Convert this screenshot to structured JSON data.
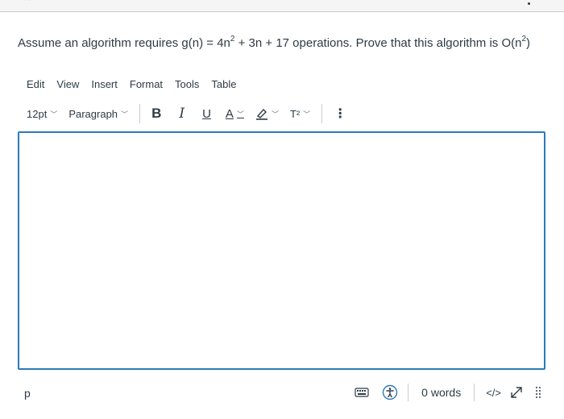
{
  "question": {
    "prefix": "Assume an algorithm requires g(n) = 4n",
    "sup1": "2",
    "middle": " + 3n + 17 operations.  Prove that this algorithm is O(n",
    "sup2": "2",
    "suffix": ")"
  },
  "menubar": {
    "items": [
      "Edit",
      "View",
      "Insert",
      "Format",
      "Tools",
      "Table"
    ]
  },
  "toolbar": {
    "font_size": "12pt",
    "block_format": "Paragraph",
    "bold": "B",
    "italic": "I",
    "underline": "U",
    "text_color": "A",
    "superscript": "T²",
    "more": "⋮"
  },
  "status": {
    "path": "p",
    "word_count": "0 words",
    "html_toggle": "</>"
  },
  "colors": {
    "editor_border": "#2b7abc",
    "text": "#2d3b45",
    "accessibility": "#2b7abc"
  }
}
